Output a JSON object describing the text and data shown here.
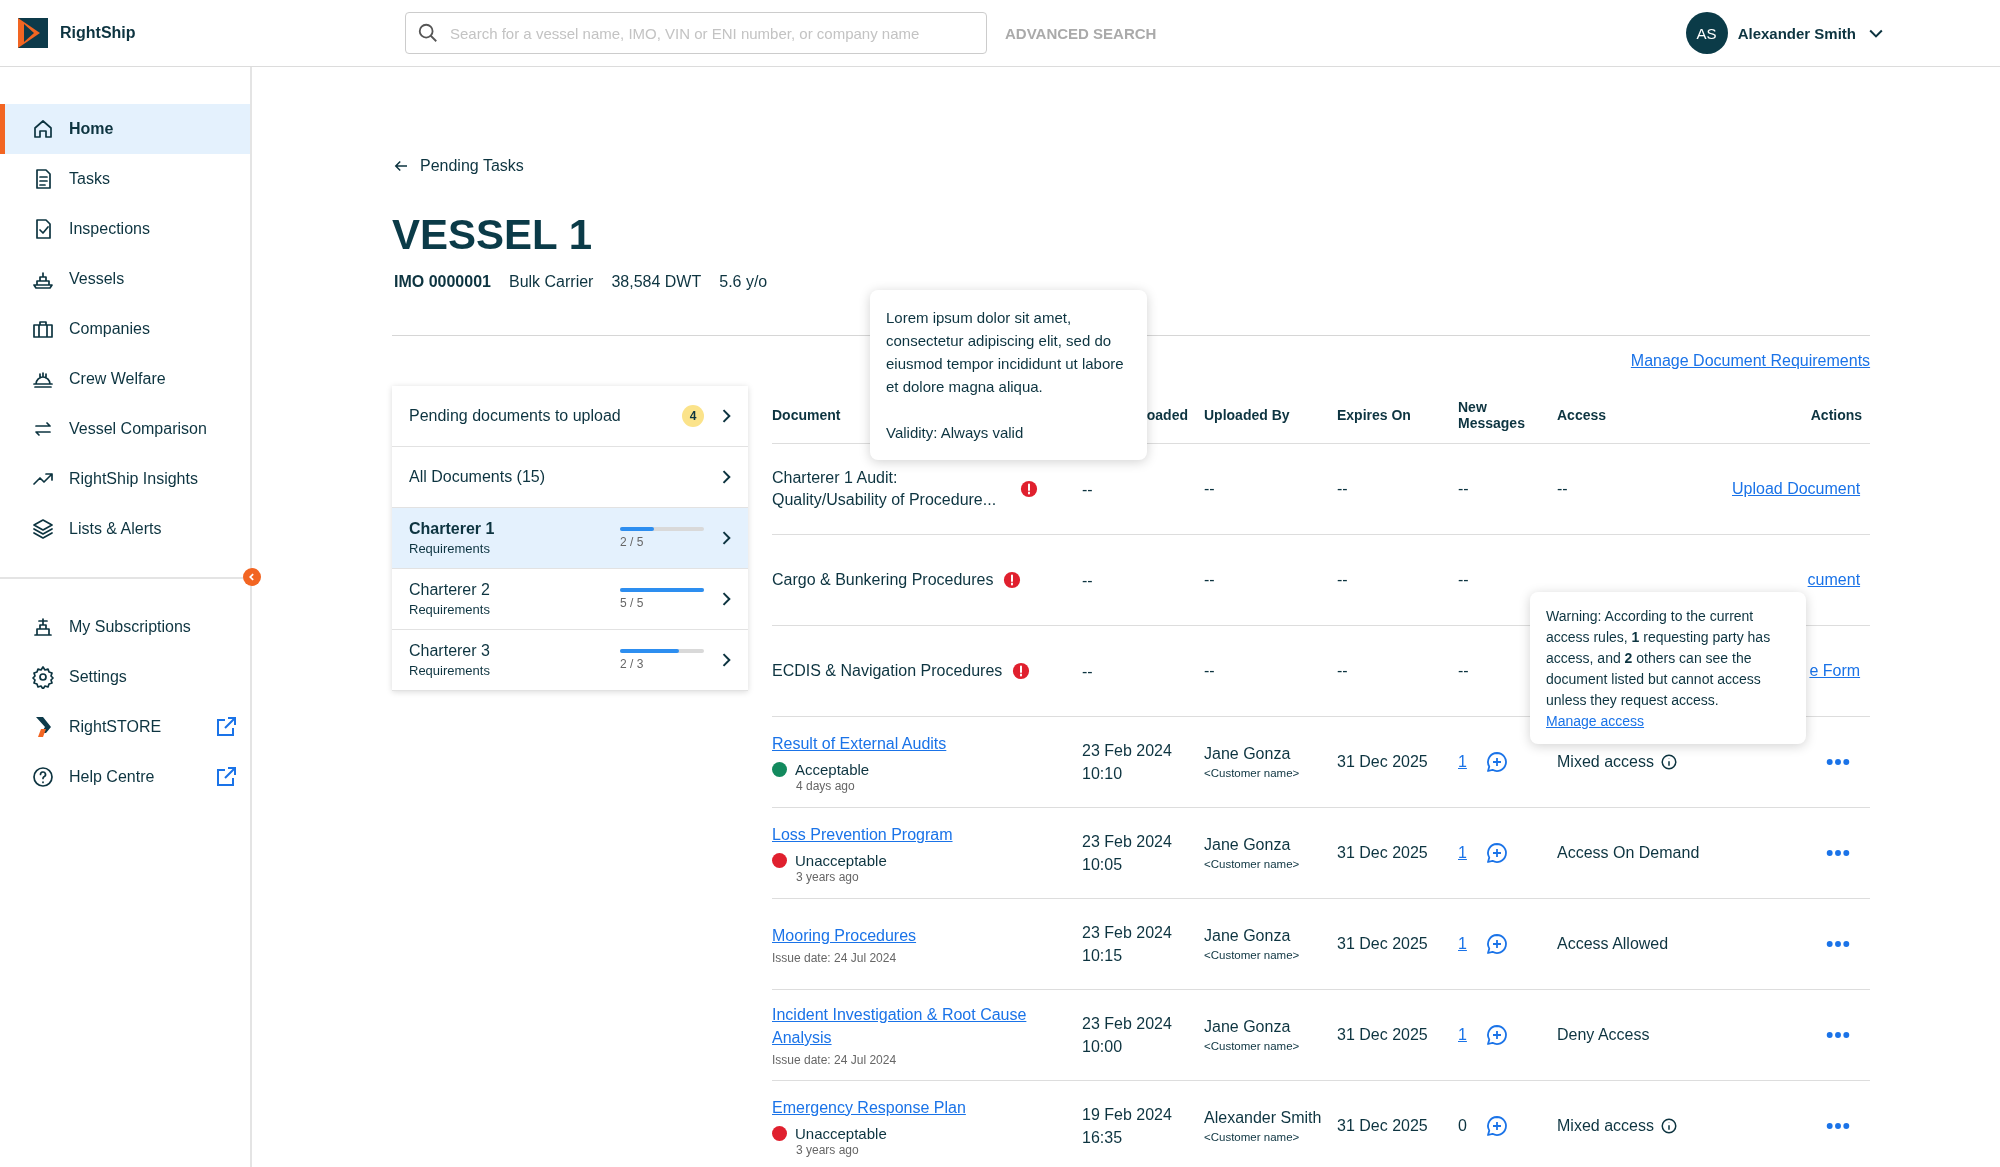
{
  "header": {
    "brand": "RightShip",
    "search": {
      "placeholder": "Search for a vessel name, IMO, VIN or ENI number, or company name"
    },
    "advanced_search": "ADVANCED SEARCH",
    "user": {
      "initials": "AS",
      "name": "Alexander Smith"
    }
  },
  "nav": [
    {
      "label": "Home",
      "selected": true
    },
    {
      "label": "Tasks",
      "selected": false
    },
    {
      "label": "Inspections",
      "selected": false
    },
    {
      "label": "Vessels",
      "selected": false
    },
    {
      "label": "Companies",
      "selected": false
    },
    {
      "label": "Crew Welfare",
      "selected": false
    },
    {
      "label": "Vessel Comparison",
      "selected": false
    },
    {
      "label": "RightShip Insights",
      "selected": false
    },
    {
      "label": "Lists & Alerts",
      "selected": false
    }
  ],
  "nav_bottom": [
    {
      "label": "My Subscriptions",
      "external": false
    },
    {
      "label": "Settings",
      "external": false
    },
    {
      "label": "RightSTORE",
      "external": true
    },
    {
      "label": "Help Centre",
      "external": true
    }
  ],
  "back_link": "Pending Tasks",
  "vessel": {
    "title": "VESSEL 1",
    "imo": "IMO 0000001",
    "type": "Bulk Carrier",
    "dwt": "38,584 DWT",
    "age": "5.6 y/o"
  },
  "doc_nav": {
    "pending": {
      "label": "Pending documents to upload",
      "count": "4"
    },
    "all": {
      "label": "All Documents (15)"
    }
  },
  "charterers": [
    {
      "name": "Charterer 1",
      "sub": "Requirements",
      "progress": "2 / 5",
      "level": 0.4,
      "selected": true
    },
    {
      "name": "Charterer 2",
      "sub": "Requirements",
      "progress": "5 / 5",
      "level": 1.0,
      "selected": false
    },
    {
      "name": "Charterer 3",
      "sub": "Requirements",
      "progress": "2 / 3",
      "level": 0.7,
      "selected": false
    }
  ],
  "manage_link": "Manage Document Requirements",
  "table": {
    "columns": [
      "Document",
      "oaded",
      "Uploaded By",
      "Expires On",
      "New Messages",
      "Access",
      "Actions"
    ],
    "rows": [
      {
        "kind": "pending",
        "document": "Charterer 1 Audit: Quality/Usability of Procedure...",
        "date": "--",
        "uploaded_by": "--",
        "expires": "--",
        "messages": "--",
        "access": "--",
        "action": "Upload Document"
      },
      {
        "kind": "pending",
        "document": "Cargo & Bunkering Procedures",
        "date": "--",
        "uploaded_by": "--",
        "expires": "--",
        "messages": "--",
        "action": "cument"
      },
      {
        "kind": "pending",
        "document": "ECDIS & Navigation Procedures",
        "date": "--",
        "uploaded_by": "--",
        "expires": "--",
        "messages": "--",
        "action": "e Form"
      },
      {
        "kind": "uploaded",
        "document": "Result of External Audits",
        "status": {
          "label": "Acceptable",
          "time": "4 days ago",
          "color": "#138a5e"
        },
        "date": "23 Feb 2024",
        "time": "10:10",
        "uploaded_by": "Jane Gonza",
        "customer": "<Customer name>",
        "expires": "31 Dec 2025",
        "messages": "1",
        "messages_linked": true,
        "access": "Mixed access",
        "access_info": true
      },
      {
        "kind": "uploaded",
        "document": "Loss Prevention Program",
        "status": {
          "label": "Unacceptable",
          "time": "3 years ago",
          "color": "#e0202e"
        },
        "date": "23 Feb 2024",
        "time": "10:05",
        "uploaded_by": "Jane Gonza",
        "customer": "<Customer name>",
        "expires": "31 Dec 2025",
        "messages": "1",
        "messages_linked": true,
        "access": "Access On Demand",
        "access_info": false
      },
      {
        "kind": "uploaded",
        "document": "Mooring Procedures",
        "issue_date": "Issue date: 24 Jul 2024",
        "date": "23 Feb 2024",
        "time": "10:15",
        "uploaded_by": "Jane Gonza",
        "customer": "<Customer name>",
        "expires": "31 Dec 2025",
        "messages": "1",
        "messages_linked": true,
        "access": "Access Allowed",
        "access_info": false
      },
      {
        "kind": "uploaded",
        "document": "Incident Investigation & Root Cause Analysis",
        "issue_date": "Issue date: 24 Jul 2024",
        "date": "23 Feb 2024",
        "time": "10:00",
        "uploaded_by": "Jane Gonza",
        "customer": "<Customer name>",
        "expires": "31 Dec 2025",
        "messages": "1",
        "messages_linked": true,
        "access": "Deny Access",
        "access_info": false
      },
      {
        "kind": "uploaded",
        "document": "Emergency Response Plan",
        "status": {
          "label": "Unacceptable",
          "time": "3 years ago",
          "color": "#e0202e"
        },
        "date": "19 Feb 2024",
        "time": "16:35",
        "uploaded_by": "Alexander Smith",
        "customer": "<Customer name>",
        "expires": "31 Dec 2025",
        "messages": "0",
        "messages_linked": false,
        "access": "Mixed access",
        "access_info": true
      }
    ]
  },
  "tooltips": [
    {
      "paragraphs": [
        "Lorem ipsum dolor sit amet, consectetur adipiscing elit, sed do eiusmod tempor incididunt ut labore et dolore magna aliqua.",
        "Validity: Always valid"
      ]
    },
    {
      "paragraphs": [
        "Warning: According to the current access rules, **1** requesting party has access, and **2** others can see the document listed but cannot access unless they request access."
      ],
      "link": "Manage access"
    }
  ]
}
